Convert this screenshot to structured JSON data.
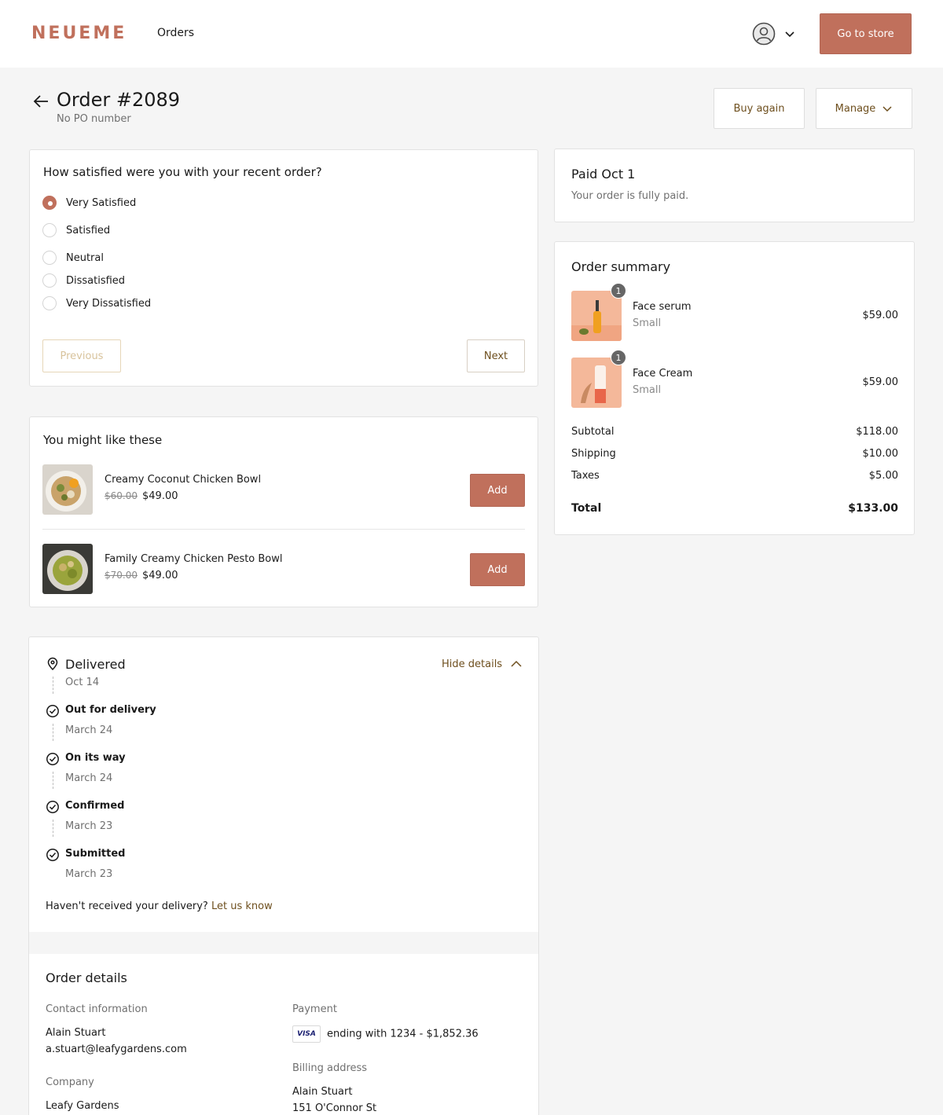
{
  "header": {
    "logo": "NEUEME",
    "nav_orders": "Orders",
    "store_button": "Go to store"
  },
  "order": {
    "title": "Order #2089",
    "po": "No PO number",
    "buy_again": "Buy again",
    "manage": "Manage"
  },
  "survey": {
    "question": "How satisfied were you with your recent order?",
    "options": [
      "Very Satisfied",
      "Satisfied",
      "Neutral",
      "Dissatisfied",
      "Very Dissatisfied"
    ],
    "selected": "Very Satisfied",
    "previous": "Previous",
    "next": "Next"
  },
  "recommendations": {
    "title": "You might like these",
    "items": [
      {
        "name": "Creamy Coconut Chicken Bowl",
        "old_price": "$60.00",
        "price": "$49.00",
        "add": "Add"
      },
      {
        "name": "Family Creamy Chicken Pesto Bowl",
        "old_price": "$70.00",
        "price": "$49.00",
        "add": "Add"
      }
    ]
  },
  "payment_status": {
    "title": "Paid Oct 1",
    "subtitle": "Your order is fully paid."
  },
  "summary": {
    "title": "Order summary",
    "items": [
      {
        "name": "Face serum",
        "variant": "Small",
        "qty": "1",
        "price": "$59.00"
      },
      {
        "name": "Face Cream",
        "variant": "Small",
        "qty": "1",
        "price": "$59.00"
      }
    ],
    "subtotal_label": "Subtotal",
    "subtotal": "$118.00",
    "shipping_label": "Shipping",
    "shipping": "$10.00",
    "taxes_label": "Taxes",
    "taxes": "$5.00",
    "total_label": "Total",
    "total": "$133.00"
  },
  "tracking": {
    "status": "Delivered",
    "status_date": "Oct 14",
    "hide_details": "Hide details",
    "steps": [
      {
        "label": "Out for delivery",
        "date": "March 24"
      },
      {
        "label": "On its way",
        "date": "March 24"
      },
      {
        "label": "Confirmed",
        "date": "March 23"
      },
      {
        "label": "Submitted",
        "date": "March 23"
      }
    ],
    "help_text": "Haven't received your delivery?",
    "help_link": "Let us know"
  },
  "details": {
    "title": "Order details",
    "contact_label": "Contact information",
    "contact_name": "Alain Stuart",
    "contact_email": "a.stuart@leafygardens.com",
    "company_label": "Company",
    "company": "Leafy Gardens",
    "payment_label": "Payment",
    "card_brand": "VISA",
    "payment_text": "ending with 1234  - $1,852.36",
    "billing_label": "Billing address",
    "billing_name": "Alain Stuart",
    "billing_street": "151 O'Connor St"
  },
  "colors": {
    "accent": "#c0705c",
    "link": "#6e4f1e"
  }
}
